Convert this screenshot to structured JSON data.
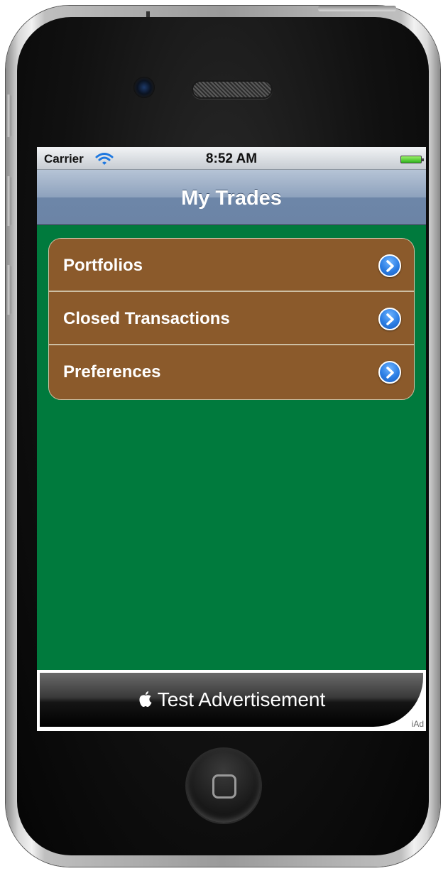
{
  "status_bar": {
    "carrier": "Carrier",
    "time": "8:52 AM",
    "wifi_icon": "wifi-icon",
    "battery_icon": "battery-icon"
  },
  "nav": {
    "title": "My Trades"
  },
  "menu": {
    "items": [
      {
        "label": "Portfolios",
        "icon": "disclosure-icon"
      },
      {
        "label": "Closed Transactions",
        "icon": "disclosure-icon"
      },
      {
        "label": "Preferences",
        "icon": "disclosure-icon"
      }
    ]
  },
  "ad": {
    "icon": "apple-icon",
    "text": "Test Advertisement",
    "badge": "iAd"
  },
  "colors": {
    "background": "#007a3d",
    "row": "#8b5a2b",
    "nav_bar": "#7a90b0",
    "disclosure": "#2b7de3"
  }
}
